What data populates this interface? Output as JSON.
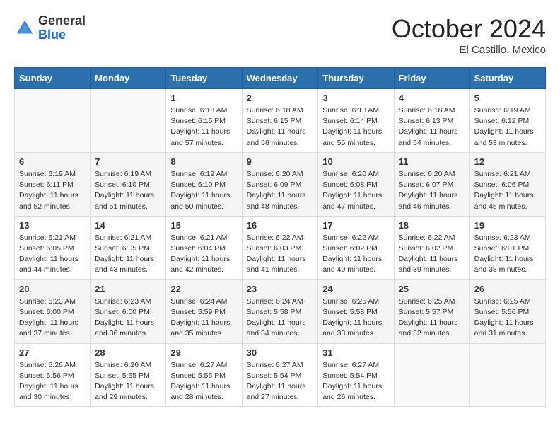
{
  "header": {
    "logo_general": "General",
    "logo_blue": "Blue",
    "month_title": "October 2024",
    "subtitle": "El Castillo, Mexico"
  },
  "days_of_week": [
    "Sunday",
    "Monday",
    "Tuesday",
    "Wednesday",
    "Thursday",
    "Friday",
    "Saturday"
  ],
  "weeks": [
    [
      {
        "day": "",
        "info": ""
      },
      {
        "day": "",
        "info": ""
      },
      {
        "day": "1",
        "info": "Sunrise: 6:18 AM\nSunset: 6:15 PM\nDaylight: 11 hours and 57 minutes."
      },
      {
        "day": "2",
        "info": "Sunrise: 6:18 AM\nSunset: 6:15 PM\nDaylight: 11 hours and 56 minutes."
      },
      {
        "day": "3",
        "info": "Sunrise: 6:18 AM\nSunset: 6:14 PM\nDaylight: 11 hours and 55 minutes."
      },
      {
        "day": "4",
        "info": "Sunrise: 6:18 AM\nSunset: 6:13 PM\nDaylight: 11 hours and 54 minutes."
      },
      {
        "day": "5",
        "info": "Sunrise: 6:19 AM\nSunset: 6:12 PM\nDaylight: 11 hours and 53 minutes."
      }
    ],
    [
      {
        "day": "6",
        "info": "Sunrise: 6:19 AM\nSunset: 6:11 PM\nDaylight: 11 hours and 52 minutes."
      },
      {
        "day": "7",
        "info": "Sunrise: 6:19 AM\nSunset: 6:10 PM\nDaylight: 11 hours and 51 minutes."
      },
      {
        "day": "8",
        "info": "Sunrise: 6:19 AM\nSunset: 6:10 PM\nDaylight: 11 hours and 50 minutes."
      },
      {
        "day": "9",
        "info": "Sunrise: 6:20 AM\nSunset: 6:09 PM\nDaylight: 11 hours and 48 minutes."
      },
      {
        "day": "10",
        "info": "Sunrise: 6:20 AM\nSunset: 6:08 PM\nDaylight: 11 hours and 47 minutes."
      },
      {
        "day": "11",
        "info": "Sunrise: 6:20 AM\nSunset: 6:07 PM\nDaylight: 11 hours and 46 minutes."
      },
      {
        "day": "12",
        "info": "Sunrise: 6:21 AM\nSunset: 6:06 PM\nDaylight: 11 hours and 45 minutes."
      }
    ],
    [
      {
        "day": "13",
        "info": "Sunrise: 6:21 AM\nSunset: 6:05 PM\nDaylight: 11 hours and 44 minutes."
      },
      {
        "day": "14",
        "info": "Sunrise: 6:21 AM\nSunset: 6:05 PM\nDaylight: 11 hours and 43 minutes."
      },
      {
        "day": "15",
        "info": "Sunrise: 6:21 AM\nSunset: 6:04 PM\nDaylight: 11 hours and 42 minutes."
      },
      {
        "day": "16",
        "info": "Sunrise: 6:22 AM\nSunset: 6:03 PM\nDaylight: 11 hours and 41 minutes."
      },
      {
        "day": "17",
        "info": "Sunrise: 6:22 AM\nSunset: 6:02 PM\nDaylight: 11 hours and 40 minutes."
      },
      {
        "day": "18",
        "info": "Sunrise: 6:22 AM\nSunset: 6:02 PM\nDaylight: 11 hours and 39 minutes."
      },
      {
        "day": "19",
        "info": "Sunrise: 6:23 AM\nSunset: 6:01 PM\nDaylight: 11 hours and 38 minutes."
      }
    ],
    [
      {
        "day": "20",
        "info": "Sunrise: 6:23 AM\nSunset: 6:00 PM\nDaylight: 11 hours and 37 minutes."
      },
      {
        "day": "21",
        "info": "Sunrise: 6:23 AM\nSunset: 6:00 PM\nDaylight: 11 hours and 36 minutes."
      },
      {
        "day": "22",
        "info": "Sunrise: 6:24 AM\nSunset: 5:59 PM\nDaylight: 11 hours and 35 minutes."
      },
      {
        "day": "23",
        "info": "Sunrise: 6:24 AM\nSunset: 5:58 PM\nDaylight: 11 hours and 34 minutes."
      },
      {
        "day": "24",
        "info": "Sunrise: 6:25 AM\nSunset: 5:58 PM\nDaylight: 11 hours and 33 minutes."
      },
      {
        "day": "25",
        "info": "Sunrise: 6:25 AM\nSunset: 5:57 PM\nDaylight: 11 hours and 32 minutes."
      },
      {
        "day": "26",
        "info": "Sunrise: 6:25 AM\nSunset: 5:56 PM\nDaylight: 11 hours and 31 minutes."
      }
    ],
    [
      {
        "day": "27",
        "info": "Sunrise: 6:26 AM\nSunset: 5:56 PM\nDaylight: 11 hours and 30 minutes."
      },
      {
        "day": "28",
        "info": "Sunrise: 6:26 AM\nSunset: 5:55 PM\nDaylight: 11 hours and 29 minutes."
      },
      {
        "day": "29",
        "info": "Sunrise: 6:27 AM\nSunset: 5:55 PM\nDaylight: 11 hours and 28 minutes."
      },
      {
        "day": "30",
        "info": "Sunrise: 6:27 AM\nSunset: 5:54 PM\nDaylight: 11 hours and 27 minutes."
      },
      {
        "day": "31",
        "info": "Sunrise: 6:27 AM\nSunset: 5:54 PM\nDaylight: 11 hours and 26 minutes."
      },
      {
        "day": "",
        "info": ""
      },
      {
        "day": "",
        "info": ""
      }
    ]
  ]
}
